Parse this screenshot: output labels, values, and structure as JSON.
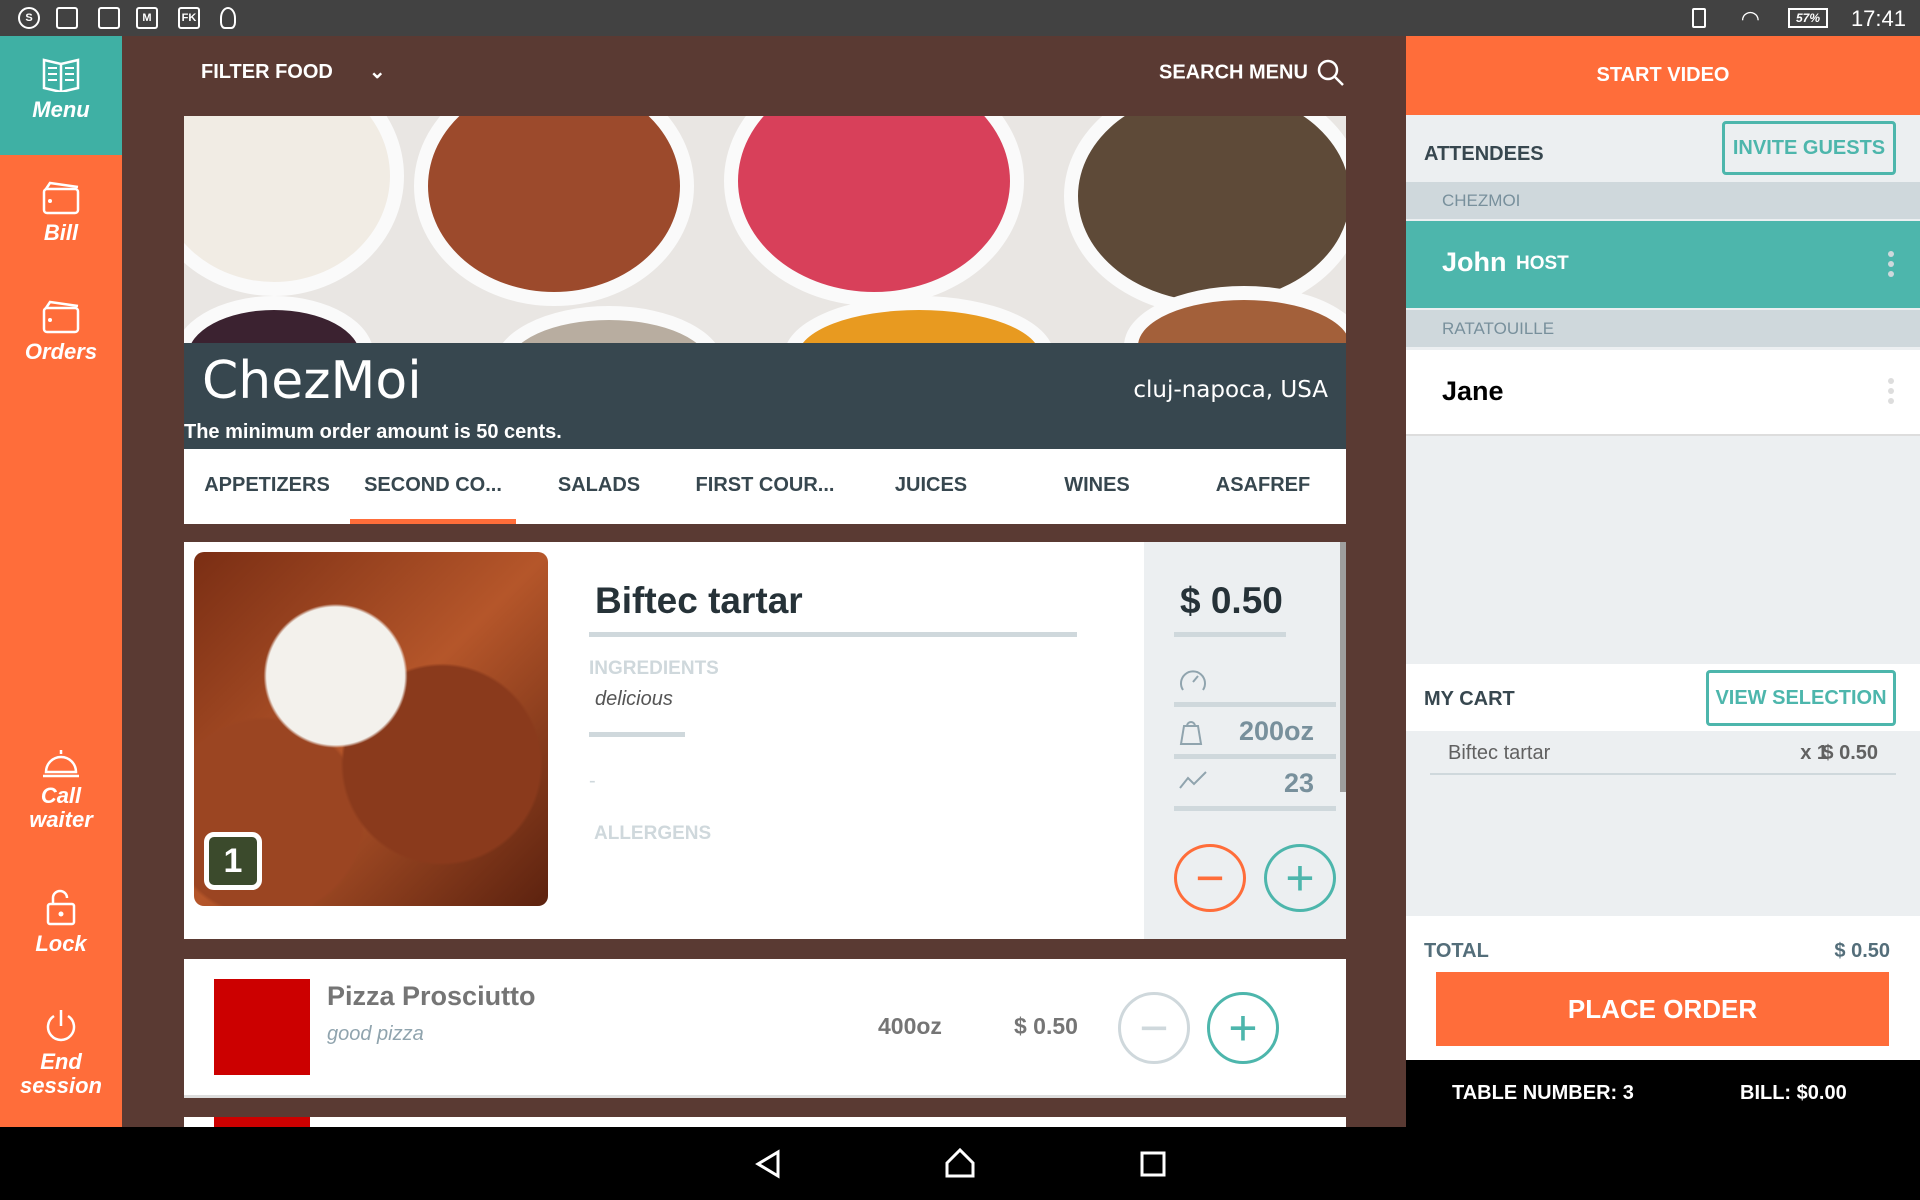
{
  "status_bar": {
    "left_icons": [
      "se-icon",
      "files-icon",
      "image-icon",
      "gmail-icon",
      "fk-icon",
      "lightbulb-icon"
    ],
    "battery": "57%",
    "time": "17:41"
  },
  "sidebar": {
    "items": [
      {
        "label": "Menu",
        "icon": "menu-book-icon",
        "active": true
      },
      {
        "label": "Bill",
        "icon": "wallet-icon"
      },
      {
        "label": "Orders",
        "icon": "wallet-icon"
      },
      {
        "label": "Call waiter",
        "icon": "bell-icon"
      },
      {
        "label": "Lock",
        "icon": "lock-icon"
      },
      {
        "label": "End session",
        "icon": "power-icon"
      }
    ]
  },
  "toolbar": {
    "filter_label": "FILTER FOOD",
    "search_label": "SEARCH MENU"
  },
  "restaurant": {
    "name": "ChezMoi",
    "location": "cluj-napoca, USA",
    "min_order": "The minimum order amount is 50 cents."
  },
  "tabs": [
    {
      "label": "APPETIZERS"
    },
    {
      "label": "SECOND CO...",
      "active": true
    },
    {
      "label": "SALADS"
    },
    {
      "label": "FIRST COUR..."
    },
    {
      "label": "JUICES"
    },
    {
      "label": "WINES"
    },
    {
      "label": "ASAFREF"
    }
  ],
  "featured": {
    "name": "Biftec tartar",
    "quantity": "1",
    "ingredients_label": "INGREDIENTS",
    "ingredients": "delicious",
    "dash": "-",
    "allergens_label": "ALLERGENS",
    "price": "$ 0.50",
    "weight": "200oz",
    "calories": "23"
  },
  "items": [
    {
      "name": "Pizza Prosciutto",
      "description": "good pizza",
      "weight": "400oz",
      "price": "$ 0.50"
    }
  ],
  "right_panel": {
    "start_video": "START VIDEO",
    "attendees_label": "ATTENDEES",
    "invite_label": "INVITE GUESTS",
    "groups": [
      {
        "label": "CHEZMOI",
        "attendee": "John",
        "badge": "HOST"
      },
      {
        "label": "RATATOUILLE",
        "attendee": "Jane"
      }
    ],
    "cart_label": "MY CART",
    "view_selection": "VIEW SELECTION",
    "cart": [
      {
        "name": "Biftec tartar",
        "qty": "x 1",
        "price": "$ 0.50"
      }
    ],
    "total_label": "TOTAL",
    "total": "$ 0.50",
    "place_order": "PLACE ORDER",
    "table_number": "TABLE NUMBER: 3",
    "bill": "BILL: $0.00"
  },
  "colors": {
    "accent_orange": "#ff6d3a",
    "teal": "#4db6ac",
    "brown": "#5a3a33",
    "dark": "#37474f"
  }
}
